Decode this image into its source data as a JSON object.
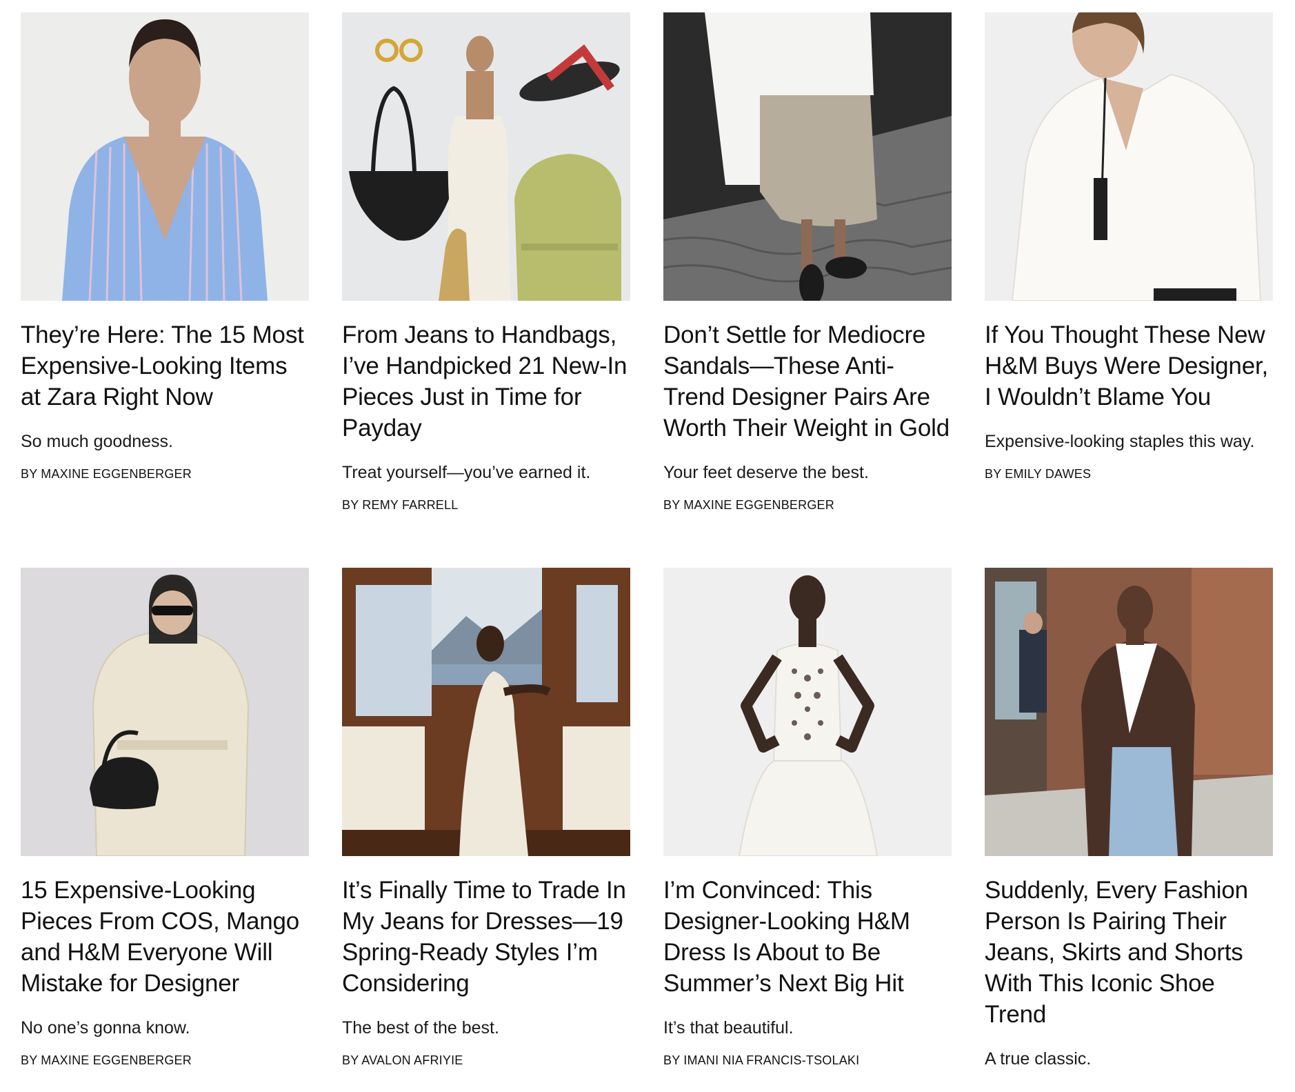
{
  "articles": [
    {
      "headline": "They’re Here: The 15 Most Expensive-Looking Items at Zara Right Now",
      "dek": "So much goodness.",
      "byline": "BY MAXINE EGGENBERGER",
      "image": "zara-striped-shirt-photo",
      "colors": {
        "bg": "#ededeb",
        "main": "#8fb3e6",
        "accent": "#c9a38a"
      }
    },
    {
      "headline": "From Jeans to Handbags, I’ve Handpicked 21 New-In Pieces Just in Time for Payday",
      "dek": "Treat yourself—you’ve earned it.",
      "byline": "BY REMY FARRELL",
      "image": "new-in-collage-photo",
      "colors": {
        "bg": "#e6e8ea",
        "main": "#f2ede3",
        "accent": "#b8bd6e"
      }
    },
    {
      "headline": "Don’t Settle for Mediocre Sandals—These Anti-Trend Designer Pairs Are Worth Their Weight in Gold",
      "dek": "Your feet deserve the best.",
      "byline": "BY MAXINE EGGENBERGER",
      "image": "street-style-sandals-photo",
      "colors": {
        "bg": "#2b2b2b",
        "main": "#b7ad9c",
        "accent": "#f4f4f2"
      }
    },
    {
      "headline": "If You Thought These New H&M Buys Were Designer, I Wouldn’t Blame You",
      "dek": "Expensive-looking staples this way.",
      "byline": "BY EMILY DAWES",
      "image": "hm-white-blouse-photo",
      "colors": {
        "bg": "#efefef",
        "main": "#fbf9f6",
        "accent": "#b88a6c"
      }
    },
    {
      "headline": "15 Expensive-Looking Pieces From COS, Mango and H&M Everyone Will Mistake for Designer",
      "dek": "No one’s gonna know.",
      "byline": "BY MAXINE EGGENBERGER",
      "image": "cream-trench-coat-photo",
      "colors": {
        "bg": "#dcdadc",
        "main": "#ebe4d2",
        "accent": "#1c1c1c"
      }
    },
    {
      "headline": "It’s Finally Time to Trade In My Jeans for Dresses—19 Spring-Ready Styles I’m Considering",
      "dek": "The best of the best.",
      "byline": "BY AVALON AFRIYIE",
      "image": "boat-white-dress-photo",
      "colors": {
        "bg": "#6b3c22",
        "main": "#efe9dc",
        "accent": "#8aa1b8"
      }
    },
    {
      "headline": "I’m Convinced: This Designer-Looking H&M Dress Is About to Be Summer’s Next Big Hit",
      "dek": "It’s that beautiful.",
      "byline": "BY IMANI NIA FRANCIS-TSOLAKI",
      "image": "hm-white-eyelet-dress-photo",
      "colors": {
        "bg": "#efefef",
        "main": "#f6f4ef",
        "accent": "#3b2a22"
      }
    },
    {
      "headline": "Suddenly, Every Fashion Person Is Pairing Their Jeans, Skirts and Shorts With This Iconic Shoe Trend",
      "dek": "A true classic.",
      "byline": "",
      "image": "street-style-leather-coat-photo",
      "colors": {
        "bg": "#8a5a45",
        "main": "#4a3128",
        "accent": "#9cb9d6"
      }
    }
  ]
}
